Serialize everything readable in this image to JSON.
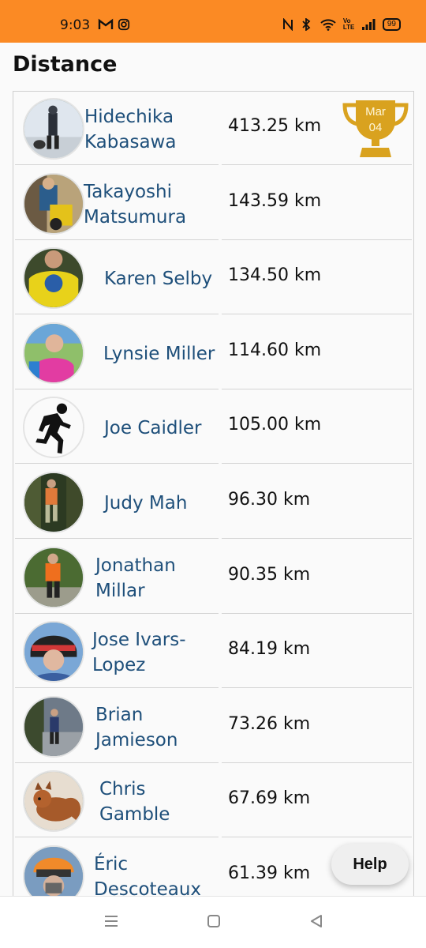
{
  "status_bar": {
    "time": "9:03",
    "left_icons": [
      "gmail-icon",
      "instagram-icon"
    ],
    "right_icons": [
      "nfc-icon",
      "bluetooth-icon",
      "wifi-icon",
      "volte-icon",
      "signal-icon"
    ],
    "volte_label": "Vo LTE",
    "battery": "99"
  },
  "page": {
    "title": "Distance"
  },
  "leaderboard": [
    {
      "name_line1": "Hidechika",
      "name_line2": "Kabasawa",
      "distance": "413.25 km",
      "trophy": {
        "month": "Mar",
        "day": "04"
      }
    },
    {
      "name_line1": "Takayoshi",
      "name_line2": "Matsumura",
      "distance": "143.59 km"
    },
    {
      "name_line1": "Karen Selby",
      "name_line2": "",
      "distance": "134.50 km"
    },
    {
      "name_line1": "Lynsie Miller",
      "name_line2": "",
      "distance": "114.60 km"
    },
    {
      "name_line1": "Joe Caidler",
      "name_line2": "",
      "distance": "105.00 km"
    },
    {
      "name_line1": "Judy Mah",
      "name_line2": "",
      "distance": "96.30 km"
    },
    {
      "name_line1": "Jonathan",
      "name_line2": "Millar",
      "distance": "90.35 km"
    },
    {
      "name_line1": "Jose Ivars-",
      "name_line2": "Lopez",
      "distance": "84.19 km"
    },
    {
      "name_line1": "Brian",
      "name_line2": "Jamieson",
      "distance": "73.26 km"
    },
    {
      "name_line1": "Chris",
      "name_line2": "Gamble",
      "distance": "67.69 km"
    },
    {
      "name_line1": "Éric",
      "name_line2": "Descoteaux",
      "distance": "61.39 km"
    }
  ],
  "help_button": {
    "label": "Help"
  },
  "colors": {
    "status_bar": "#fb8a24",
    "name_text": "#1e4f7a",
    "trophy": "#d9a21f"
  },
  "nav_bar": {
    "icons": [
      "menu-icon",
      "home-icon",
      "back-icon"
    ]
  }
}
